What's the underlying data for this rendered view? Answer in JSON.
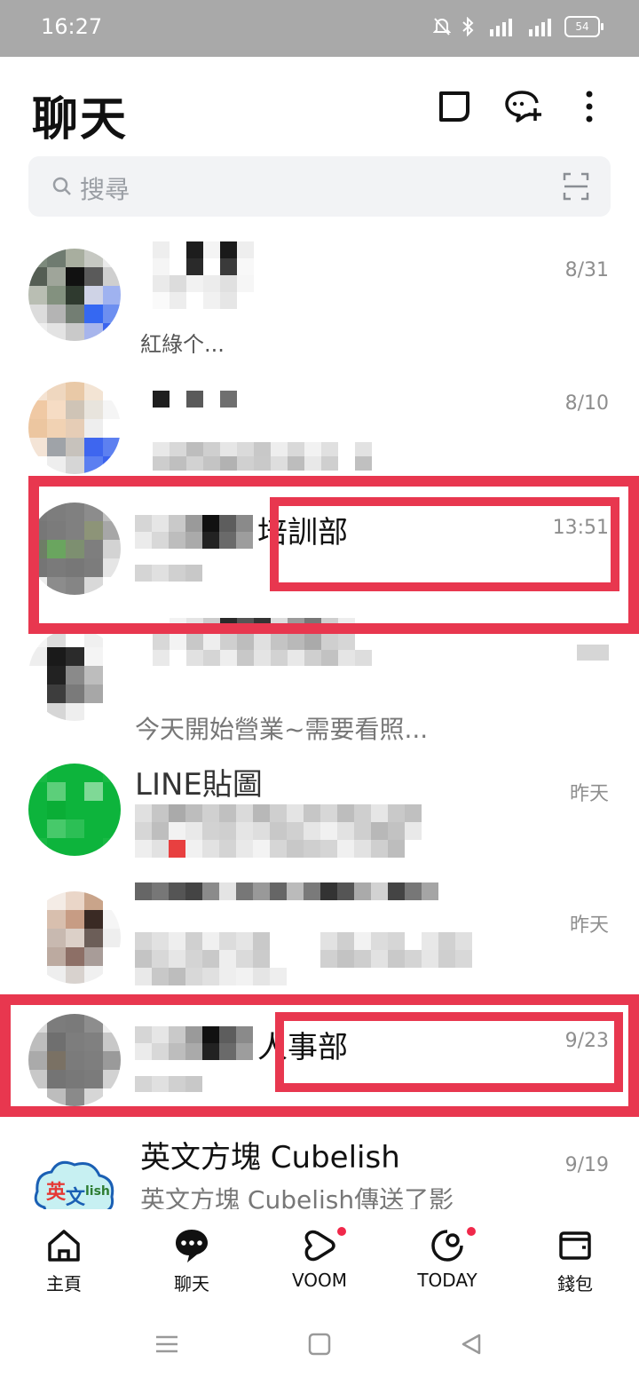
{
  "status_bar": {
    "time": "16:27",
    "battery": "54"
  },
  "header": {
    "title": "聊天"
  },
  "search": {
    "placeholder": "搜尋"
  },
  "chats": [
    {
      "time": "8/31",
      "preview_visible": "紅綠个..."
    },
    {
      "time": "8/10"
    },
    {
      "name_visible": "培訓部",
      "time": "13:51"
    },
    {
      "preview_visible": "今天開始營業~需要看照..."
    },
    {
      "name_visible": "LINE貼圖",
      "time": "昨天"
    },
    {
      "time": "昨天"
    },
    {
      "name_visible": "人事部",
      "time": "9/23"
    },
    {
      "name": "英文方塊 Cubelish",
      "preview": "英文方塊 Cubelish傳送了影",
      "time": "9/19"
    }
  ],
  "bottom_nav": [
    {
      "label": "主頁",
      "icon": "home-icon"
    },
    {
      "label": "聊天",
      "icon": "chat-icon",
      "active": true
    },
    {
      "label": "VOOM",
      "icon": "voom-icon",
      "badge": true
    },
    {
      "label": "TODAY",
      "icon": "today-icon",
      "badge": true
    },
    {
      "label": "錢包",
      "icon": "wallet-icon"
    }
  ],
  "colors": {
    "highlight": "#e8374f",
    "badge": "#f0284a",
    "line_green": "#07b53b"
  }
}
